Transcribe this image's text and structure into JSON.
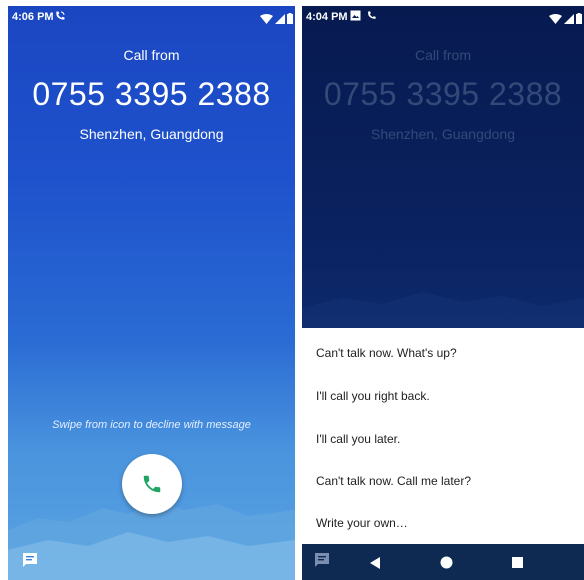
{
  "incoming": {
    "status": {
      "time": "4:06 PM"
    },
    "caller": {
      "label": "Call from",
      "number": "0755 3395 2388",
      "location": "Shenzhen, Guangdong"
    },
    "hint": "Swipe from icon to decline with message",
    "icons": {
      "answer": "phone-icon",
      "message": "message-icon"
    }
  },
  "quick_reply": {
    "status": {
      "time": "4:04 PM"
    },
    "caller": {
      "label": "Call from",
      "number": "0755 3395 2388",
      "location": "Shenzhen, Guangdong"
    },
    "replies": [
      "Can't talk now. What's up?",
      "I'll call you right back.",
      "I'll call you later.",
      "Can't talk now. Call me later?",
      "Write your own…"
    ],
    "nav": [
      "back-icon",
      "home-icon",
      "recents-icon"
    ]
  },
  "colors": {
    "accent_green": "#1fa463",
    "background_blue": "#1e4fcb",
    "dimmed_navy": "#0a1f5a",
    "navbar": "#0f2a52"
  }
}
